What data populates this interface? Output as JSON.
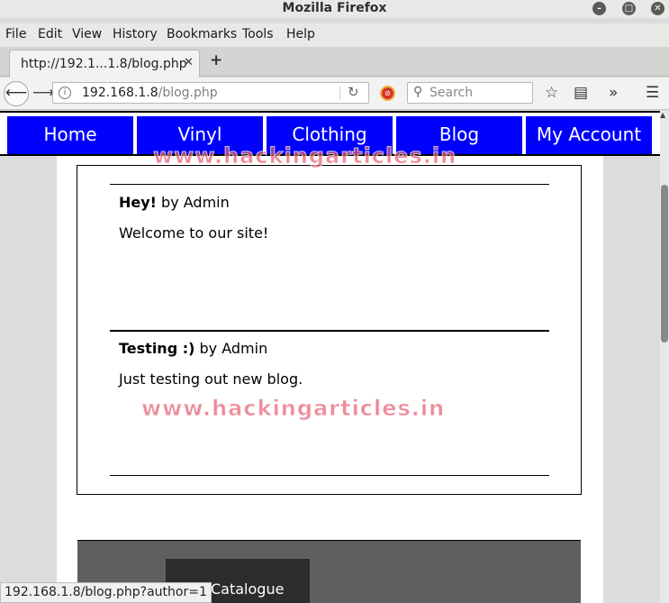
{
  "window": {
    "title": "Mozilla Firefox"
  },
  "menu": {
    "items": [
      "File",
      "Edit",
      "View",
      "History",
      "Bookmarks",
      "Tools",
      "Help"
    ]
  },
  "tab": {
    "title": "http://192.1...1.8/blog.php",
    "close": "✕",
    "new": "+"
  },
  "urlbar": {
    "host": "192.168.1.8",
    "path": "/blog.php"
  },
  "search": {
    "placeholder": "Search"
  },
  "site_nav": [
    "Home",
    "Vinyl",
    "Clothing",
    "Blog",
    "My Account"
  ],
  "posts": [
    {
      "title": "Hey!",
      "byline": " by Admin",
      "body": "Welcome to our site!"
    },
    {
      "title": "Testing :)",
      "byline": " by Admin",
      "body": "Just testing out new blog."
    }
  ],
  "footer": {
    "menu_item": "Catalogue"
  },
  "watermark": "www.hackingarticles.in",
  "status": {
    "url": "192.168.1.8/blog.php?author=1"
  },
  "colors": {
    "nav_blue": "#0000ff",
    "footer_gray": "#5f5f5f"
  },
  "icons": [
    "minimize-icon",
    "maximize-icon",
    "close-icon",
    "back-icon",
    "forward-icon",
    "info-icon",
    "reload-icon",
    "addon-block-icon",
    "search-icon",
    "star-icon",
    "reader-icon",
    "overflow-icon",
    "hamburger-icon"
  ]
}
